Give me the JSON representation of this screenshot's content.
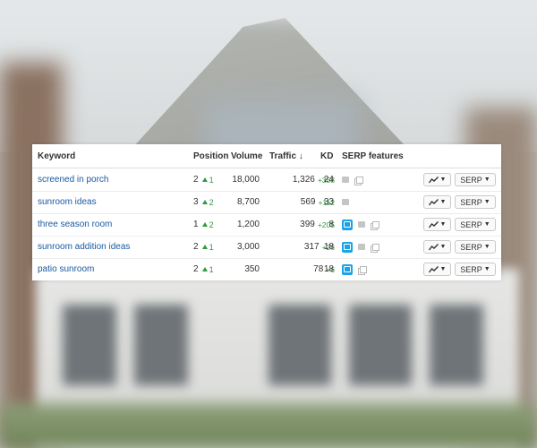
{
  "columns": {
    "keyword": "Keyword",
    "position": "Position",
    "volume": "Volume",
    "traffic": "Traffic ↓",
    "kd": "KD",
    "serp_features": "SERP features"
  },
  "rows": [
    {
      "keyword": "screened in porch",
      "position": "2",
      "position_change": "1",
      "volume": "18,000",
      "traffic": "1,326",
      "traffic_change": "+358",
      "kd": "24",
      "features": [
        "snippet-icon",
        "pages-icon"
      ]
    },
    {
      "keyword": "sunroom ideas",
      "position": "3",
      "position_change": "2",
      "volume": "8,700",
      "traffic": "569",
      "traffic_change": "+112",
      "kd": "33",
      "features": [
        "snippet-icon"
      ]
    },
    {
      "keyword": "three season room",
      "position": "1",
      "position_change": "2",
      "volume": "1,200",
      "traffic": "399",
      "traffic_change": "+205",
      "kd": "8",
      "features": [
        "image-pack-icon",
        "snippet-icon",
        "pages-icon"
      ]
    },
    {
      "keyword": "sunroom addition ideas",
      "position": "2",
      "position_change": "1",
      "volume": "3,000",
      "traffic": "317",
      "traffic_change": "+26",
      "kd": "18",
      "features": [
        "image-pack-icon",
        "snippet-icon",
        "pages-icon"
      ]
    },
    {
      "keyword": "patio sunroom",
      "position": "2",
      "position_change": "1",
      "volume": "350",
      "traffic": "78",
      "traffic_change": "+6",
      "kd": "18",
      "features": [
        "image-pack-icon",
        "pages-icon"
      ]
    }
  ],
  "buttons": {
    "serp_label": "SERP",
    "caret": "▼"
  },
  "colors": {
    "link": "#1a5aa0",
    "positive": "#2e9a3e",
    "image_feature": "#1ba3e6"
  }
}
